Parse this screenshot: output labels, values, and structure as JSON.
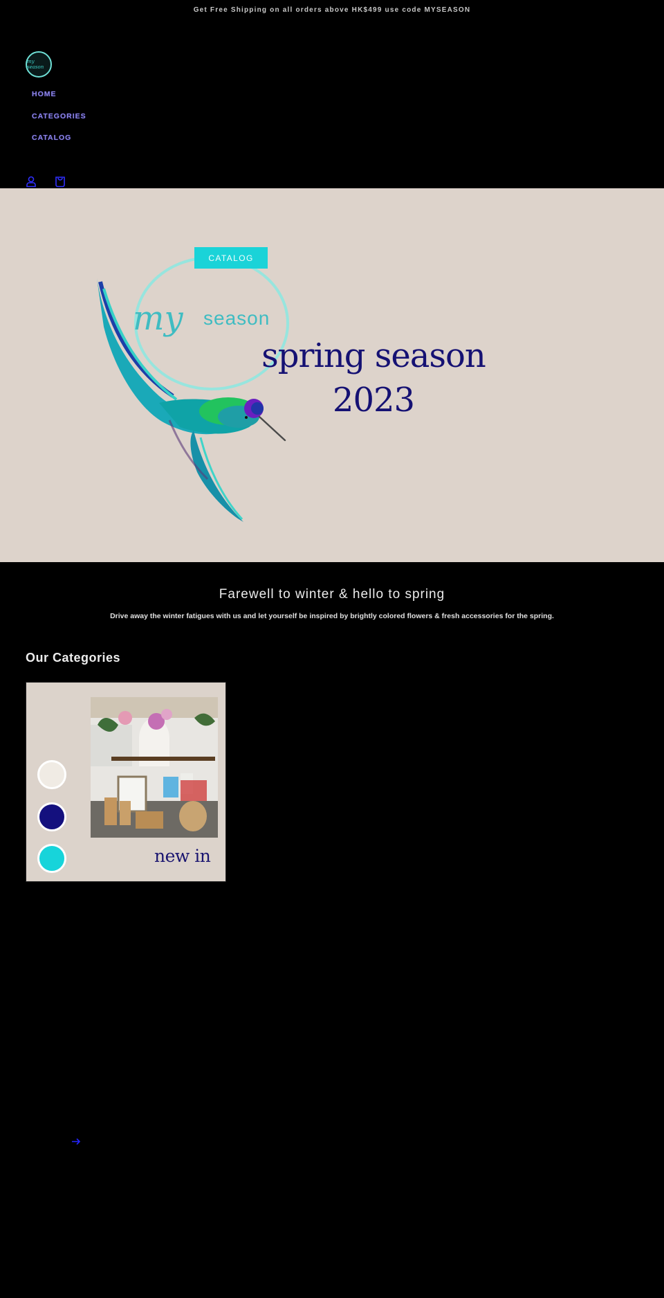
{
  "announcement": {
    "text": "Get Free Shipping on all orders above HK$499 use code MYSEASON"
  },
  "header": {
    "logo_text": "my season",
    "nav": [
      {
        "label": "HOME"
      },
      {
        "label": "CATEGORIES"
      },
      {
        "label": "CATALOG"
      }
    ],
    "icons": {
      "account": "account-icon",
      "cart": "cart-icon"
    }
  },
  "hero": {
    "button_label": "CATALOG",
    "brand_script": "my",
    "brand_word": "season",
    "title_line1": "spring season",
    "title_line2": "2023",
    "background": "#ddd3cb",
    "accent": "#1ad3d8",
    "title_color": "#151173"
  },
  "intro": {
    "heading": "Farewell to winter & hello to spring",
    "description": "Drive away the winter fatigues with us and let yourself be inspired by brightly colored flowers & fresh accessories for the spring."
  },
  "categories": {
    "title": "Our Categories",
    "items": [
      {
        "label": "new in",
        "swatches": [
          "#f0ebe4",
          "#14107e",
          "#17d4da"
        ]
      }
    ],
    "next_icon": "arrow-right-icon"
  }
}
